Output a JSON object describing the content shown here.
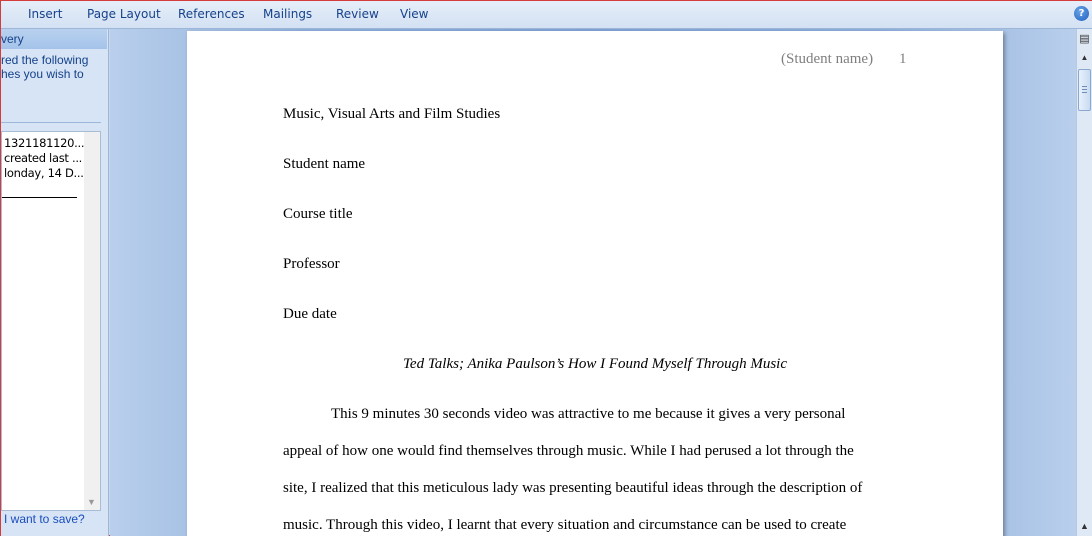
{
  "ribbon": {
    "tabs": [
      "Insert",
      "Page Layout",
      "References",
      "Mailings",
      "Review",
      "View"
    ],
    "help_label": "?"
  },
  "pane": {
    "header": "very",
    "desc": [
      "red the following",
      "hes you wish to"
    ],
    "files": [
      "1321181120...",
      "created last ...",
      "londay, 14 D..."
    ],
    "link": "I want to save?"
  },
  "document": {
    "header_name": "(Student name)",
    "page_number": "1",
    "lines": [
      "Music, Visual Arts and Film Studies",
      "Student name",
      "Course title",
      "Professor",
      "Due date"
    ],
    "title": "Ted Talks; Anika Paulson’s How I Found Myself Through Music",
    "body": [
      "This 9 minutes 30 seconds video was attractive to me because it gives a very personal",
      "appeal of how one would find themselves through music. While I had perused a lot through the",
      "site, I realized that this meticulous lady was presenting beautiful ideas through the description of",
      "music. Through this video, I learnt that every situation and circumstance can be used to create"
    ]
  },
  "icons": {
    "help": "help-icon",
    "view_ruler": "view-ruler-icon",
    "scroll_up": "scroll-up-icon",
    "previous_page": "previous-page-icon"
  },
  "colors": {
    "ribbon_text": "#15428b",
    "doc_background": "#8fb0dc",
    "header_gray": "#7f7f7f",
    "link": "#1a4dbd"
  }
}
